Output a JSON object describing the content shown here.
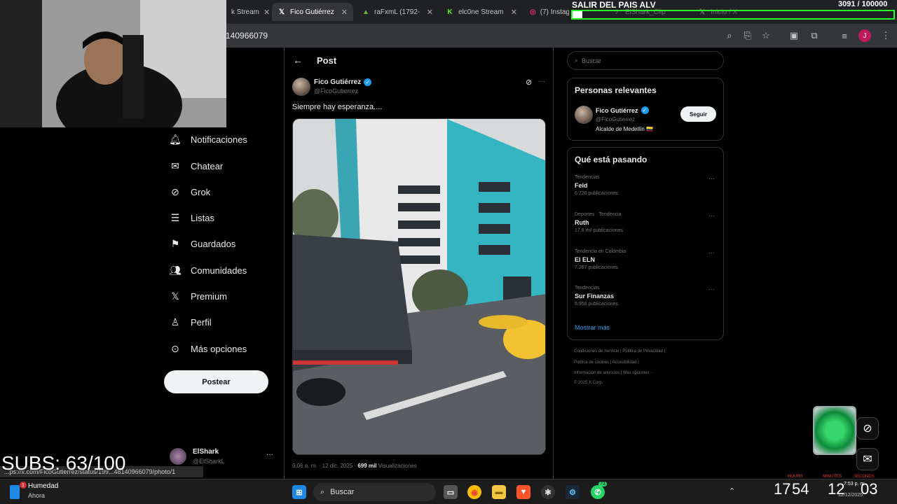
{
  "browser": {
    "tabs": [
      {
        "label": "k Stream",
        "favicon": "stream-icon",
        "active": false
      },
      {
        "label": "Fico Gutiérrez",
        "favicon": "x-icon",
        "active": true
      },
      {
        "label": "raFxmL (1792-",
        "favicon": "triangle-icon",
        "active": false
      },
      {
        "label": "elc0ne Stream",
        "favicon": "kick-icon",
        "active": false
      },
      {
        "label": "(7) Instagram",
        "favicon": "instagram-icon",
        "active": false
      },
      {
        "label": "ElShark_Clip",
        "favicon": "tiktok-icon",
        "active": false
      },
      {
        "label": "Inicio / X",
        "favicon": "x-icon",
        "active": false
      }
    ],
    "url": "140966079",
    "profile_initial": "J"
  },
  "overlay": {
    "goal_title": "SALIR DEL PAIS ALV",
    "goal_count": "3091 / 100000",
    "goal_progress": 0.031,
    "subs": "SUBS: 63/100",
    "status_url": "...ps://x.com/FicoGutierrez/status/199...48140966079/photo/1"
  },
  "nav": {
    "items": [
      {
        "label": "Notificaciones",
        "icon": "bell-icon"
      },
      {
        "label": "Chatear",
        "icon": "envelope-icon"
      },
      {
        "label": "Grok",
        "icon": "grok-icon"
      },
      {
        "label": "Listas",
        "icon": "list-icon"
      },
      {
        "label": "Guardados",
        "icon": "bookmark-icon"
      },
      {
        "label": "Comunidades",
        "icon": "people-icon"
      },
      {
        "label": "Premium",
        "icon": "x-icon"
      },
      {
        "label": "Perfil",
        "icon": "person-icon"
      },
      {
        "label": "Más opciones",
        "icon": "more-circle-icon"
      }
    ],
    "post_button": "Postear",
    "account_name": "ElShark",
    "account_handle": "@ElSharkL",
    "account_more": "···"
  },
  "post": {
    "back_icon": "←",
    "header": "Post",
    "author_name": "Fico Gutiérrez",
    "author_handle": "@FicoGutierrez",
    "more": "···",
    "text": "Siempre hay esperanza....",
    "timestamp": "9:06 a. m. · 12 dic. 2025 · ",
    "views_count": "699 mil",
    "views_label": " Visualizaciones"
  },
  "right": {
    "search_placeholder": "Buscar",
    "relevant_title": "Personas relevantes",
    "relevant_person": {
      "name": "Fico Gutiérrez",
      "handle": "@FicoGutierrez",
      "bio": "Alcalde de Medellín 🇨🇴",
      "follow_label": "Seguir"
    },
    "trends_title": "Qué está pasando",
    "trends": [
      {
        "meta": "Tendencias",
        "name": "Feid",
        "count": "6.726 publicaciones"
      },
      {
        "meta": "Deportes · Tendencia",
        "name": "Ruth",
        "count": "17,8 mil publicaciones"
      },
      {
        "meta": "Tendencia en Colombia",
        "name": "El ELN",
        "count": "7.267 publicaciones"
      },
      {
        "meta": "Tendencias",
        "name": "Sur Finanzas",
        "count": "8.958 publicaciones"
      }
    ],
    "show_more": "Mostrar más",
    "footer": [
      "Condiciones de Servicio  |  Política de Privacidad  |",
      "Política de cookies  |  Accesibilidad  |",
      "Información de anuncios  |  Más opciones ···",
      "© 2025 X Corp."
    ]
  },
  "taskbar": {
    "weather_label": "Humedad",
    "weather_sub": "Ahora",
    "weather_badge": "1",
    "search_label": "Buscar",
    "whatsapp_badge": "73",
    "clock_time": "7:53 p. m.",
    "clock_date": "12/12/2025",
    "timer_hours": "17",
    "timer_minutes": "54",
    "timer_h2": "12",
    "timer_s": "03",
    "timer_labels": [
      "HOURS",
      "MINUTES",
      "SECONDS"
    ]
  },
  "colors": {
    "accent": "#1d9bf0",
    "background": "#000000",
    "border": "#2f3336",
    "progress_border": "#2aff2a"
  }
}
